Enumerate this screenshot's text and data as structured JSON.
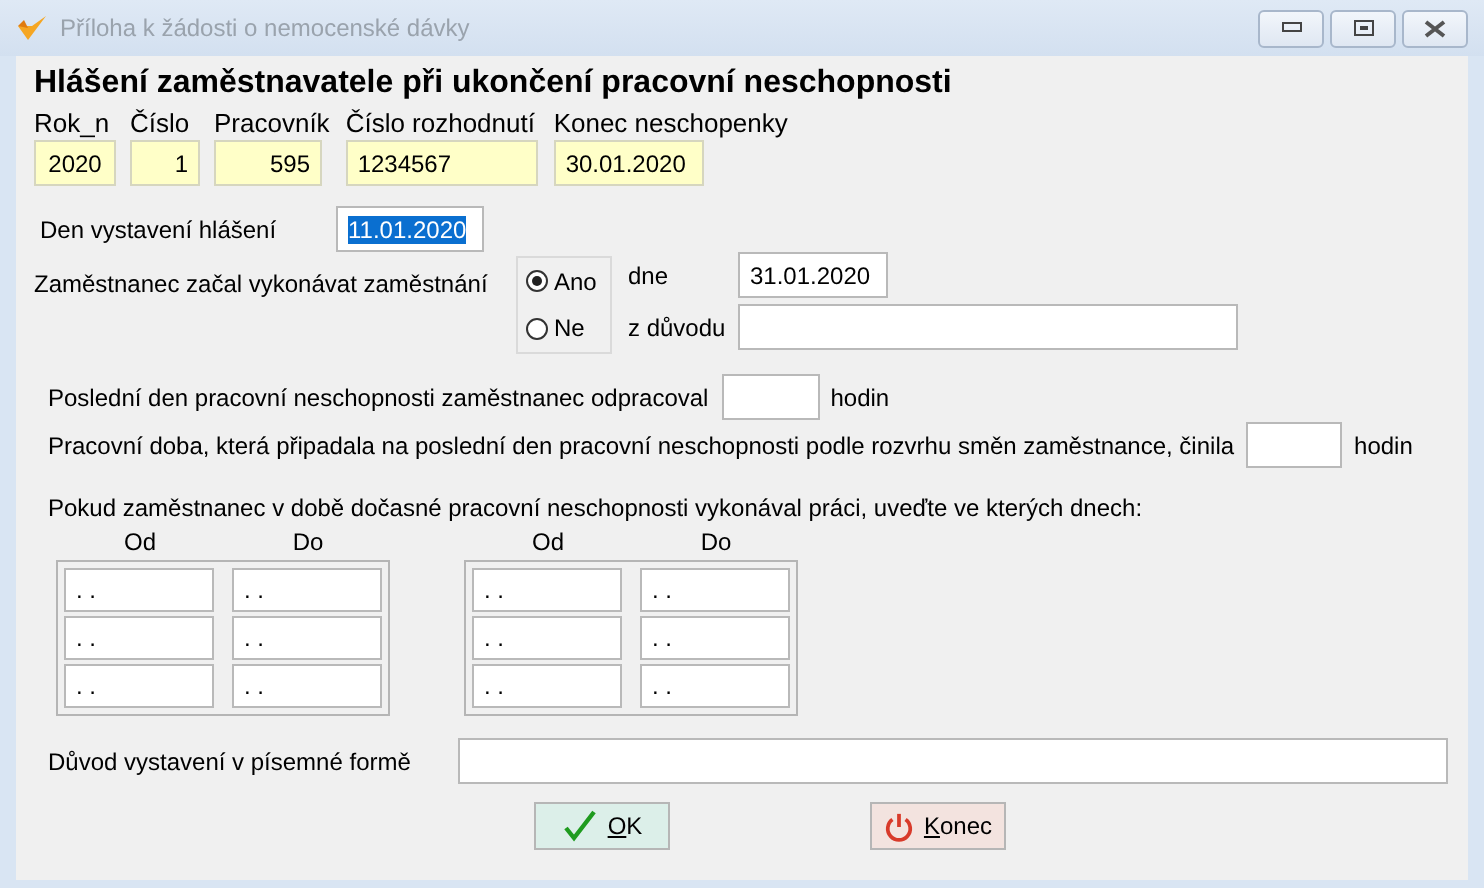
{
  "window": {
    "title": "Příloha k žádosti o nemocenské dávky"
  },
  "heading": "Hlášení zaměstnavatele při ukončení pracovní neschopnosti",
  "header_fields": [
    {
      "label": "Rok_n",
      "value": "2020",
      "kind": "year"
    },
    {
      "label": "Číslo",
      "value": "1",
      "kind": "number"
    },
    {
      "label": "Pracovník",
      "value": "595",
      "kind": "number"
    },
    {
      "label": "Číslo rozhodnutí",
      "value": "1234567",
      "kind": "text"
    },
    {
      "label": "Konec neschopenky",
      "value": "30.01.2020",
      "kind": "text"
    }
  ],
  "issue_date": {
    "label": "Den vystavení hlášení",
    "value": "11.01.2020",
    "text_selected": true
  },
  "employment": {
    "label": "Zaměstnanec začal vykonávat zaměstnání",
    "options": [
      {
        "label": "Ano",
        "selected": true,
        "field_label": "dne",
        "value": "31.01.2020"
      },
      {
        "label": "Ne",
        "selected": false,
        "field_label": "z důvodu"
      }
    ]
  },
  "last_day": {
    "label": "Poslední den pracovní neschopnosti zaměstnanec odpracoval",
    "unit": "hodin"
  },
  "work_time": {
    "label": "Pracovní doba, která připadala na poslední den pracovní neschopnosti podle rozvrhu směn zaměstnance, činila",
    "unit": "hodin"
  },
  "periods": {
    "label": "Pokud zaměstnanec v době dočasné pracovní neschopnosti vykonával práci, uveďte ve kterých dnech:",
    "groups": [
      {
        "from_label": "Od",
        "to_label": "Do",
        "rows": [
          {
            "from": ". .",
            "to": ". ."
          },
          {
            "from": ". .",
            "to": ". ."
          },
          {
            "from": ". .",
            "to": ". ."
          }
        ]
      },
      {
        "from_label": "Od",
        "to_label": "Do",
        "rows": [
          {
            "from": ". .",
            "to": ". ."
          },
          {
            "from": ". .",
            "to": ". ."
          },
          {
            "from": ". .",
            "to": ". ."
          }
        ]
      }
    ]
  },
  "written_reason": {
    "label": "Důvod vystavení v písemné formě"
  },
  "buttons": [
    {
      "kind": "ok",
      "label": "OK",
      "mnemonic": true
    },
    {
      "kind": "exit",
      "label": "Konec",
      "mnemonic": true
    }
  ]
}
